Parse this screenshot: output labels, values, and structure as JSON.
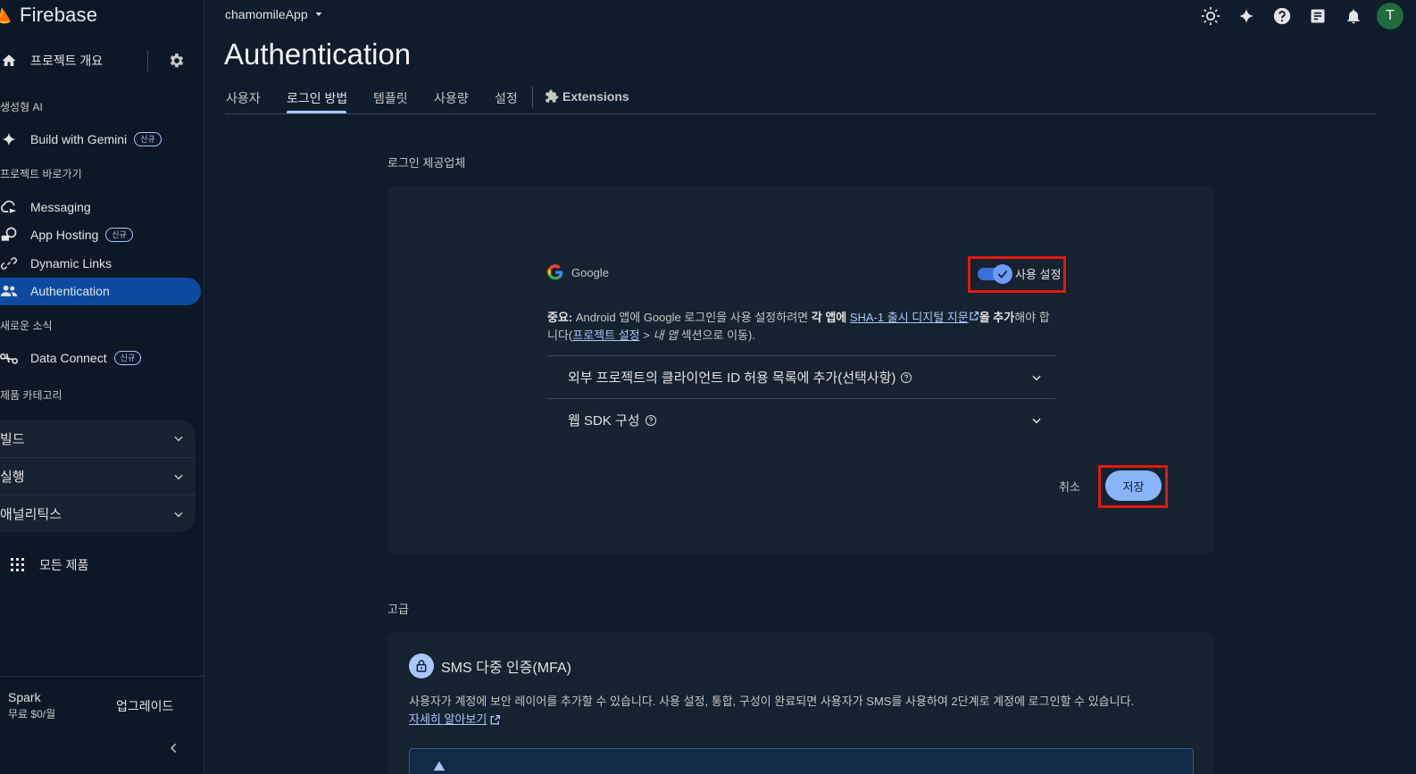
{
  "brand": {
    "name": "Firebase"
  },
  "sidebar": {
    "overview": "프로젝트 개요",
    "section_ai": "생성형 AI",
    "build_with_gemini": "Build with Gemini",
    "badge_new": "신규",
    "section_shortcuts": "프로젝트 바로가기",
    "items": [
      {
        "label": "Messaging"
      },
      {
        "label": "App Hosting"
      },
      {
        "label": "Dynamic Links"
      },
      {
        "label": "Authentication"
      }
    ],
    "section_news": "새로운 소식",
    "data_connect": "Data Connect",
    "section_categories": "제품 카테고리",
    "groups": [
      {
        "label": "빌드"
      },
      {
        "label": "실행"
      },
      {
        "label": "애널리틱스"
      }
    ],
    "all_products": "모든 제품",
    "plan_name": "Spark",
    "plan_price": "무료 $0/월",
    "upgrade": "업그레이드"
  },
  "topbar": {
    "project": "chamomileApp",
    "avatar_initial": "T"
  },
  "page": {
    "title": "Authentication",
    "tabs": [
      "사용자",
      "로그인 방법",
      "템플릿",
      "사용량",
      "설정",
      "Extensions"
    ]
  },
  "providers": {
    "heading": "로그인 제공업체",
    "provider_name": "Google",
    "enable_label": "사용 설정",
    "note": {
      "bold_prefix": "중요:",
      "text1": " Android 앱에 Google 로그인을 사용 설정하려면 ",
      "bold_each_app": "각 앱에",
      "link_sha": "SHA-1 출시 디지털 지문",
      "bold_add": "을 추가",
      "text2": "해야 합니다(",
      "link_project_settings": "프로젝트 설정",
      "text3": " > ",
      "italic_my_apps": "내 앱",
      "text4": " 섹션으로 이동)."
    },
    "accordion": [
      {
        "label": "외부 프로젝트의 클라이언트 ID 허용 목록에 추가(선택사항)"
      },
      {
        "label": "웹 SDK 구성"
      }
    ],
    "cancel": "취소",
    "save": "저장"
  },
  "advanced": {
    "heading": "고급",
    "mfa_title": "SMS 다중 인증(MFA)",
    "mfa_desc": "사용자가 계정에 보안 레이어를 추가할 수 있습니다. 사용 설정, 통합, 구성이 완료되면 사용자가 SMS를 사용하여 2단계로 계정에 로그인할 수 있습니다.",
    "learn_more": "자세히 알아보기"
  },
  "colors": {
    "accent": "#a8c7fa",
    "active_bg": "#0b4a9e",
    "highlight": "#e0190f",
    "save_bg": "#8ab4f8"
  }
}
